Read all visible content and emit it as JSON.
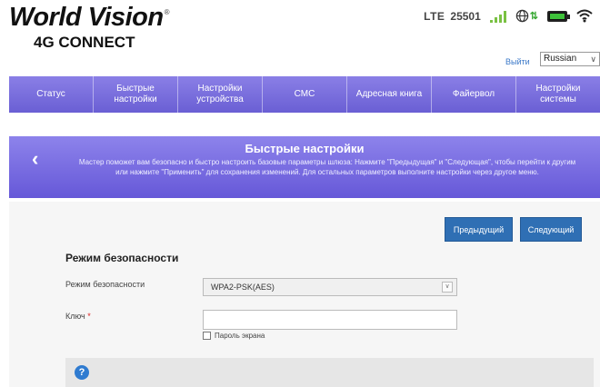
{
  "brand": {
    "name": "World Vision",
    "reg_mark": "®",
    "product": "4G CONNECT"
  },
  "status_bar": {
    "network_type": "LTE",
    "network_code": "25501",
    "signal_icon": "signal-bars-icon",
    "data_icon": "globe-data-icon",
    "battery_icon": "battery-icon",
    "wifi_icon": "wifi-icon",
    "signal_color": "#7ac143",
    "battery_color": "#3ec13a"
  },
  "top_links": {
    "logout": "Выйти",
    "language": "Russian"
  },
  "nav": {
    "items": [
      {
        "label": "Статус"
      },
      {
        "label": "Быстрые настройки"
      },
      {
        "label": "Настройки устройства"
      },
      {
        "label": "СМС"
      },
      {
        "label": "Адресная книга"
      },
      {
        "label": "Файервол"
      },
      {
        "label": "Настройки системы"
      }
    ]
  },
  "wizard": {
    "back_symbol": "‹",
    "title": "Быстрые настройки",
    "description": "Мастер поможет вам безопасно и быстро настроить базовые параметры шлюза: Нажмите \"Предыдущая\" и \"Следующая\", чтобы перейти к другим или нажмите \"Применить\" для сохранения изменений. Для остальных параметров выполните настройки через другое меню."
  },
  "buttons": {
    "prev": "Предыдущий",
    "next": "Следующий"
  },
  "form": {
    "section_title": "Режим безопасности",
    "security_label": "Режим безопасности",
    "security_value": "WPA2-PSK(AES)",
    "key_label": "Ключ",
    "key_required": "*",
    "key_value": "",
    "show_password_label": "Пароль экрана"
  },
  "help": {
    "icon": "help-icon",
    "symbol": "?"
  },
  "colors": {
    "accent": "#6a5fd4",
    "button": "#2f6fb4"
  }
}
